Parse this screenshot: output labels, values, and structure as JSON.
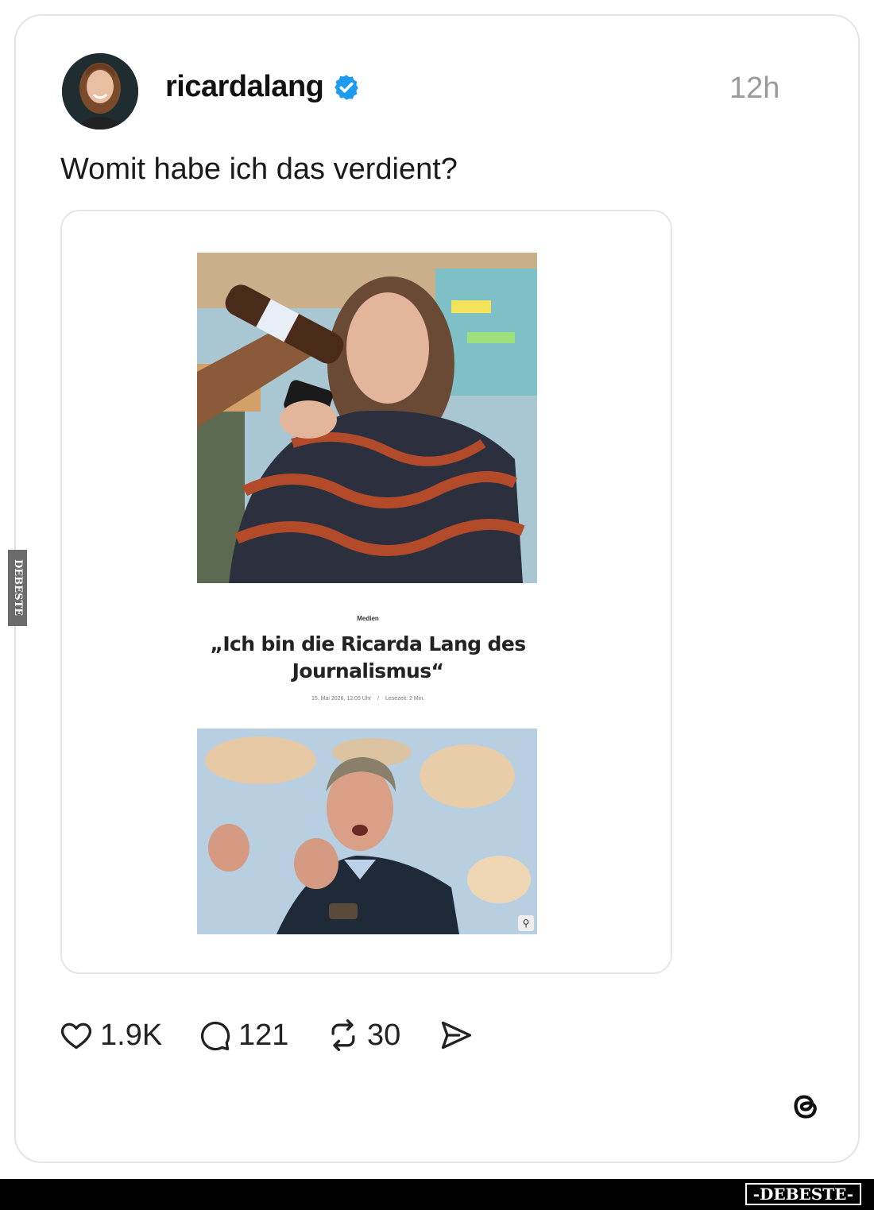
{
  "post": {
    "username": "ricardalang",
    "timestamp": "12h",
    "text": "Womit habe ich das verdient?"
  },
  "embedded_article": {
    "kicker": "Medien",
    "headline": "„Ich bin die Ricarda Lang des Journalismus“",
    "date": "15. Mai 2026, 12:05 Uhr",
    "reading_time": "Lesezeit: 2 Min."
  },
  "actions": {
    "likes": "1.9K",
    "replies": "121",
    "reposts": "30"
  },
  "icons": {
    "verified": "verified-badge-icon",
    "like": "heart-icon",
    "reply": "comment-bubble-icon",
    "repost": "repost-icon",
    "share": "send-icon",
    "brand": "threads-logo-icon",
    "zoom": "magnifier-icon"
  },
  "watermark": {
    "bottom": "-DEBESTE-",
    "side": "DEBESTE"
  },
  "colors": {
    "verified_blue": "#1d9bf0",
    "timestamp_gray": "#9a9a9a",
    "card_border": "#e4e4e4"
  }
}
